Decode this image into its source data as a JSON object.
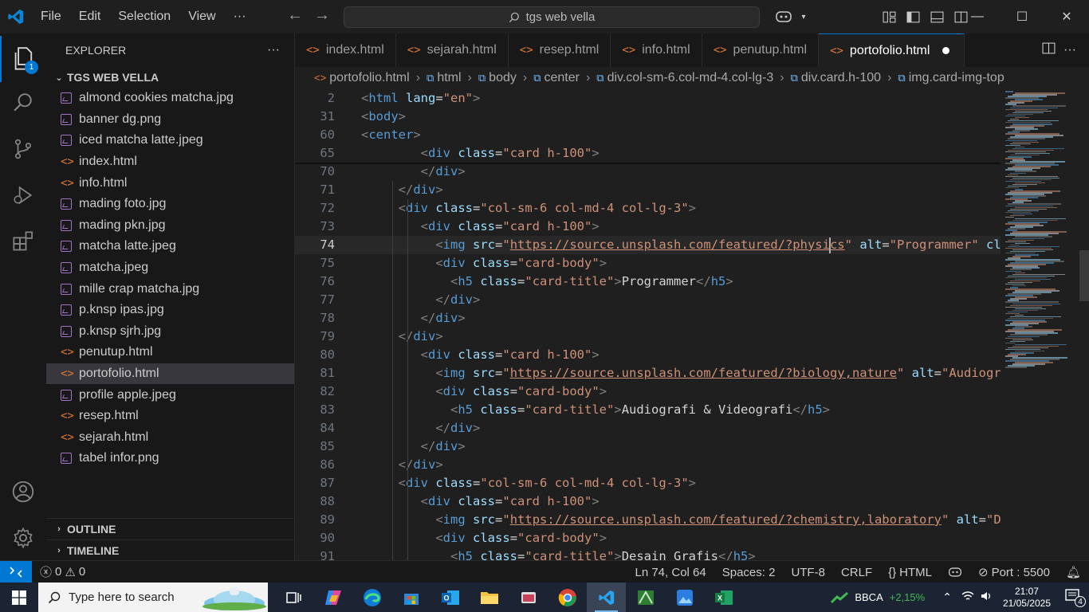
{
  "titlebar": {
    "menu": [
      "File",
      "Edit",
      "Selection",
      "View",
      "···"
    ],
    "search": "tgs web vella"
  },
  "activity": {
    "explorer_badge": "1"
  },
  "sidebar": {
    "header": "EXPLORER",
    "more": "···",
    "folder": "TGS WEB VELLA",
    "files": [
      {
        "name": "almond cookies matcha.jpg",
        "type": "img"
      },
      {
        "name": "banner dg.png",
        "type": "img"
      },
      {
        "name": "iced matcha latte.jpeg",
        "type": "img"
      },
      {
        "name": "index.html",
        "type": "html"
      },
      {
        "name": "info.html",
        "type": "html"
      },
      {
        "name": "mading foto.jpg",
        "type": "img"
      },
      {
        "name": "mading pkn.jpg",
        "type": "img"
      },
      {
        "name": "matcha latte.jpeg",
        "type": "img"
      },
      {
        "name": "matcha.jpeg",
        "type": "img"
      },
      {
        "name": "mille crap matcha.jpg",
        "type": "img"
      },
      {
        "name": "p.knsp ipas.jpg",
        "type": "img"
      },
      {
        "name": "p.knsp sjrh.jpg",
        "type": "img"
      },
      {
        "name": "penutup.html",
        "type": "html"
      },
      {
        "name": "portofolio.html",
        "type": "html"
      },
      {
        "name": "profile apple.jpeg",
        "type": "img"
      },
      {
        "name": "resep.html",
        "type": "html"
      },
      {
        "name": "sejarah.html",
        "type": "html"
      },
      {
        "name": "tabel infor.png",
        "type": "img"
      }
    ],
    "selected": "portofolio.html",
    "outline": "OUTLINE",
    "timeline": "TIMELINE"
  },
  "tabs": [
    {
      "label": "index.html"
    },
    {
      "label": "sejarah.html"
    },
    {
      "label": "resep.html"
    },
    {
      "label": "info.html"
    },
    {
      "label": "penutup.html"
    },
    {
      "label": "portofolio.html",
      "active": true
    }
  ],
  "breadcrumb": [
    "portofolio.html",
    "html",
    "body",
    "center",
    "div.col-sm-6.col-md-4.col-lg-3",
    "div.card.h-100",
    "img.card-img-top"
  ],
  "editor": {
    "sticky": [
      {
        "n": "2",
        "code": "<html lang=\"en\">"
      },
      {
        "n": "31",
        "code": "<body>"
      },
      {
        "n": "60",
        "code": "<center>"
      },
      {
        "n": "65",
        "code": "        <div class=\"card h-100\">"
      }
    ],
    "lines": [
      {
        "n": "70",
        "code": "        </div>"
      },
      {
        "n": "71",
        "code": "     </div>"
      },
      {
        "n": "72",
        "code": "     <div class=\"col-sm-6 col-md-4 col-lg-3\">"
      },
      {
        "n": "73",
        "code": "        <div class=\"card h-100\">"
      },
      {
        "n": "74",
        "code": "          <img src=\"https://source.unsplash.com/featured/?physics\" alt=\"Programmer\" class"
      },
      {
        "n": "75",
        "code": "          <div class=\"card-body\">"
      },
      {
        "n": "76",
        "code": "            <h5 class=\"card-title\">Programmer</h5>"
      },
      {
        "n": "77",
        "code": "          </div>"
      },
      {
        "n": "78",
        "code": "        </div>"
      },
      {
        "n": "79",
        "code": "     </div>"
      },
      {
        "n": "80",
        "code": "        <div class=\"card h-100\">"
      },
      {
        "n": "81",
        "code": "          <img src=\"https://source.unsplash.com/featured/?biology,nature\" alt=\"Audiografi"
      },
      {
        "n": "82",
        "code": "          <div class=\"card-body\">"
      },
      {
        "n": "83",
        "code": "            <h5 class=\"card-title\">Audiografi & Videografi</h5>"
      },
      {
        "n": "84",
        "code": "          </div>"
      },
      {
        "n": "85",
        "code": "        </div>"
      },
      {
        "n": "86",
        "code": "     </div>"
      },
      {
        "n": "87",
        "code": "     <div class=\"col-sm-6 col-md-4 col-lg-3\">"
      },
      {
        "n": "88",
        "code": "        <div class=\"card h-100\">"
      },
      {
        "n": "89",
        "code": "          <img src=\"https://source.unsplash.com/featured/?chemistry,laboratory\" alt=\"Des"
      },
      {
        "n": "90",
        "code": "          <div class=\"card-body\">"
      },
      {
        "n": "91",
        "code": "            <h5 class=\"card-title\">Desain Grafis</h5>"
      }
    ],
    "current_line": "74"
  },
  "status": {
    "errors": "0",
    "warnings": "0",
    "position": "Ln 74, Col 64",
    "spaces": "Spaces: 2",
    "encoding": "UTF-8",
    "eol": "CRLF",
    "language": "HTML",
    "port": "Port : 5500",
    "notifications": "4"
  },
  "taskbar": {
    "search_placeholder": "Type here to search",
    "stock_name": "BBCA",
    "stock_change": "+2,15%",
    "time": "21:07",
    "date": "21/05/2025"
  },
  "colors": {
    "accent": "#0078d4",
    "tag": "#569cd6",
    "attr": "#9cdcfe",
    "string": "#ce9178",
    "html_icon": "#e37933"
  }
}
